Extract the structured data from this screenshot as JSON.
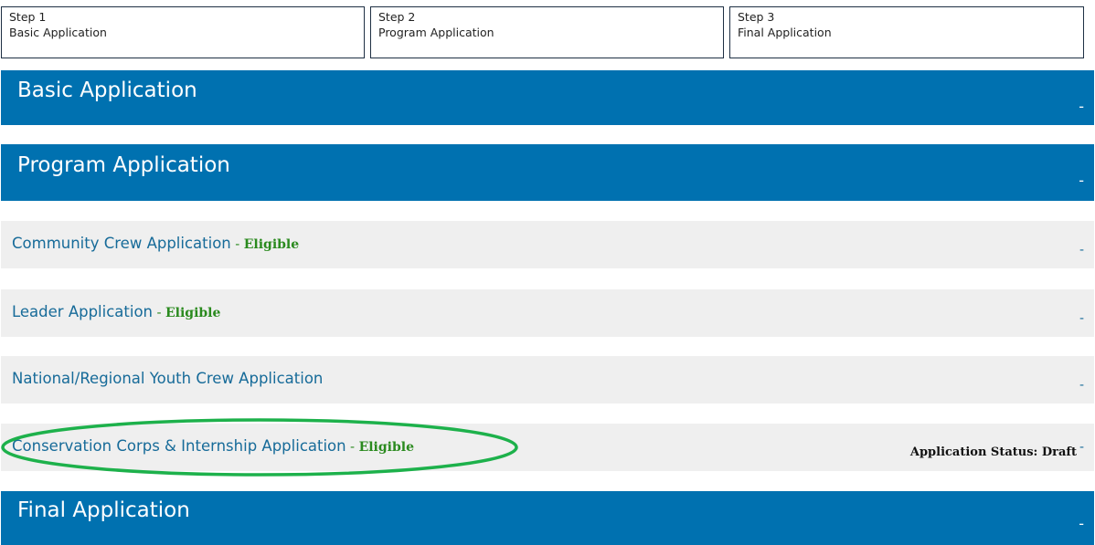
{
  "steps": [
    {
      "number": "Step 1",
      "name": "Basic Application"
    },
    {
      "number": "Step 2",
      "name": "Program Application"
    },
    {
      "number": "Step 3",
      "name": "Final Application"
    }
  ],
  "sections": {
    "basic": {
      "title": "Basic Application",
      "toggle": "-"
    },
    "program": {
      "title": "Program Application",
      "toggle": "-"
    },
    "final": {
      "title": "Final Application",
      "toggle": "-"
    }
  },
  "program_items": [
    {
      "label": "Community Crew Application",
      "separator": " - ",
      "eligibility": "Eligible",
      "toggle": "-"
    },
    {
      "label": "Leader Application",
      "separator": " - ",
      "eligibility": "Eligible",
      "toggle": "-"
    },
    {
      "label": "National/Regional Youth Crew Application",
      "toggle": "-"
    },
    {
      "label": "Conservation Corps & Internship Application",
      "separator": " - ",
      "eligibility": "Eligible",
      "status": "Application Status: Draft",
      "toggle": "-"
    }
  ],
  "colors": {
    "header_blue": "#0071b0",
    "row_grey": "#efefef",
    "link_blue": "#176b99",
    "eligible_green": "#2a8a1e",
    "highlight_green": "#1db14b"
  }
}
